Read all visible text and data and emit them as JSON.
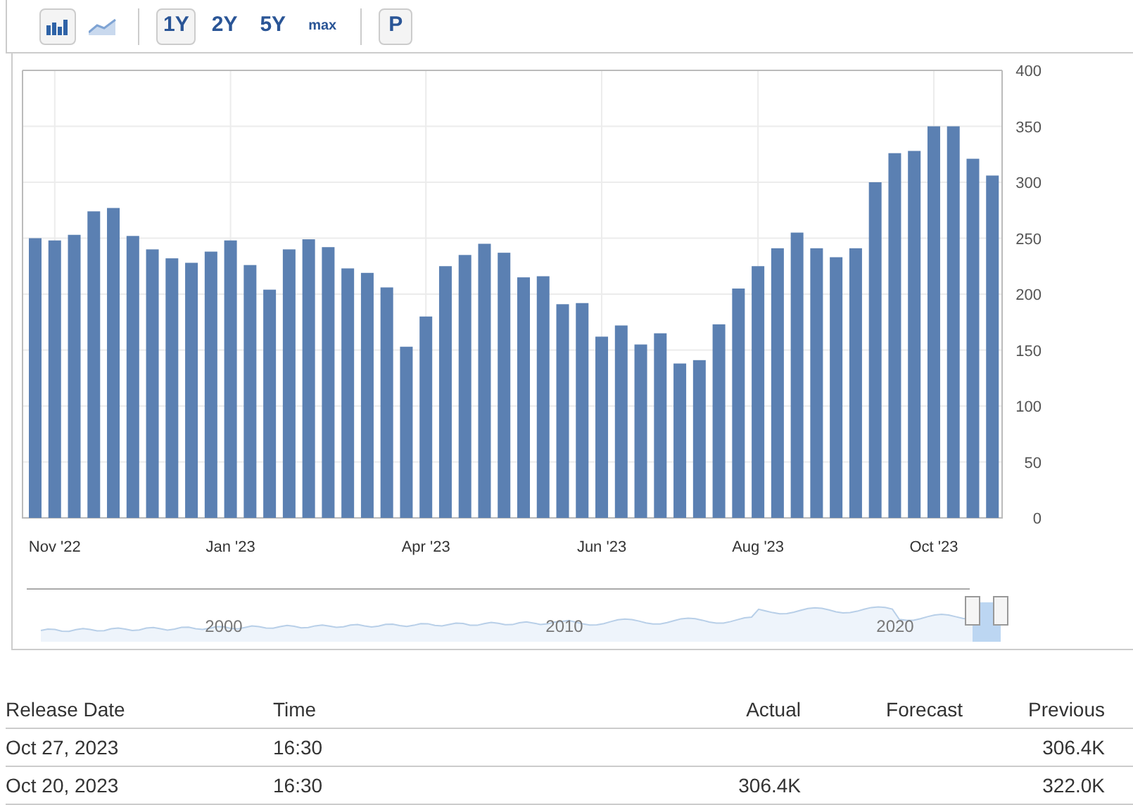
{
  "toolbar": {
    "chart_types": [
      {
        "kind": "bar",
        "selected": true
      },
      {
        "kind": "line",
        "selected": false
      }
    ],
    "ranges": [
      {
        "label": "1Y",
        "selected": true
      },
      {
        "label": "2Y",
        "selected": false
      },
      {
        "label": "5Y",
        "selected": false
      },
      {
        "label": "max",
        "selected": false
      }
    ],
    "extra_button": "P"
  },
  "chart_data": {
    "type": "bar",
    "categories": [
      null,
      "Nov '22",
      null,
      null,
      null,
      null,
      null,
      null,
      null,
      null,
      "Jan '23",
      null,
      null,
      null,
      null,
      null,
      null,
      null,
      null,
      null,
      "Apr '23",
      null,
      null,
      null,
      null,
      null,
      null,
      null,
      null,
      "Jun '23",
      null,
      null,
      null,
      null,
      null,
      null,
      null,
      "Aug '23",
      null,
      null,
      null,
      null,
      null,
      null,
      null,
      null,
      "Oct '23",
      null,
      null,
      null
    ],
    "values": [
      250,
      248,
      253,
      274,
      277,
      252,
      240,
      232,
      228,
      238,
      248,
      226,
      204,
      240,
      249,
      242,
      223,
      219,
      206,
      153,
      180,
      225,
      235,
      245,
      237,
      215,
      216,
      191,
      192,
      162,
      172,
      155,
      165,
      138,
      141,
      173,
      205,
      225,
      241,
      255,
      241,
      233,
      241,
      300,
      326,
      328,
      350,
      350,
      321,
      306
    ],
    "ylim": [
      0,
      400
    ],
    "grid": true,
    "yticks": [
      0,
      50,
      100,
      150,
      200,
      250,
      300,
      350,
      400
    ]
  },
  "navigator": {
    "labels": [
      "2000",
      "2010",
      "2020"
    ]
  },
  "table": {
    "columns": [
      "Release Date",
      "Time",
      "Actual",
      "Forecast",
      "Previous"
    ],
    "rows": [
      {
        "cells": [
          "Oct 27, 2023",
          "16:30",
          "",
          "",
          "306.4K"
        ]
      },
      {
        "cells": [
          "Oct 20, 2023",
          "16:30",
          "306.4K",
          "",
          "322.0K"
        ]
      }
    ]
  }
}
